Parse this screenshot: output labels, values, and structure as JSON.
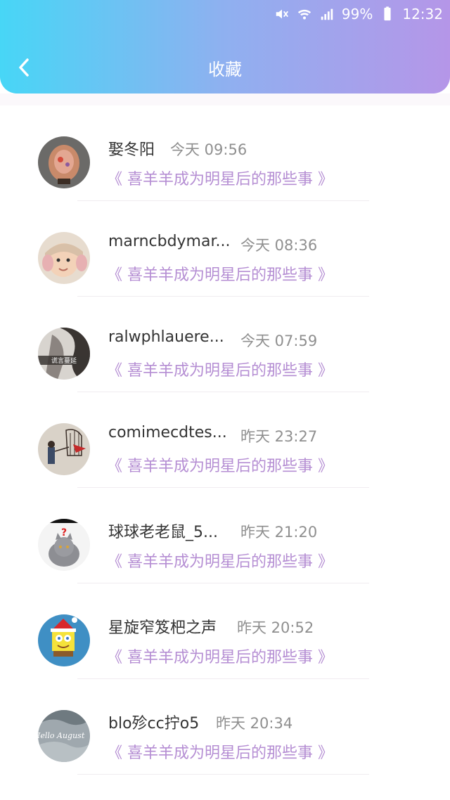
{
  "status_bar": {
    "battery": "99%",
    "time": "12:32",
    "icons": [
      "mute-icon",
      "wifi-icon",
      "signal-icon",
      "battery-icon"
    ]
  },
  "header": {
    "title": "收藏",
    "back_icon": "chevron-left-icon"
  },
  "colors": {
    "gradient_start": "#47d6f6",
    "gradient_end": "#b596e8",
    "link": "#b58ed3",
    "time": "#8f8f8f"
  },
  "items": [
    {
      "name": "娶冬阳",
      "time": "今天 09:56",
      "title": "《 喜羊羊成为明星后的那些事 》"
    },
    {
      "name": "marncbdymar...",
      "time": "今天 08:36",
      "title": "《 喜羊羊成为明星后的那些事 》"
    },
    {
      "name": "ralwphlauere...",
      "time": "今天 07:59",
      "title": "《 喜羊羊成为明星后的那些事 》",
      "avatar_text": "谎言蔓延"
    },
    {
      "name": "comimecdtes...",
      "time": "昨天 23:27",
      "title": "《 喜羊羊成为明星后的那些事 》"
    },
    {
      "name": "球球老老鼠_5...",
      "time": "昨天 21:20",
      "title": "《 喜羊羊成为明星后的那些事 》"
    },
    {
      "name": "星旋窄笈杷之声",
      "time": "昨天 20:52",
      "title": "《 喜羊羊成为明星后的那些事 》"
    },
    {
      "name": "blo殄cc拧o5",
      "time": "昨天 20:34",
      "title": "《 喜羊羊成为明星后的那些事 》",
      "avatar_text": "Hello August"
    }
  ]
}
